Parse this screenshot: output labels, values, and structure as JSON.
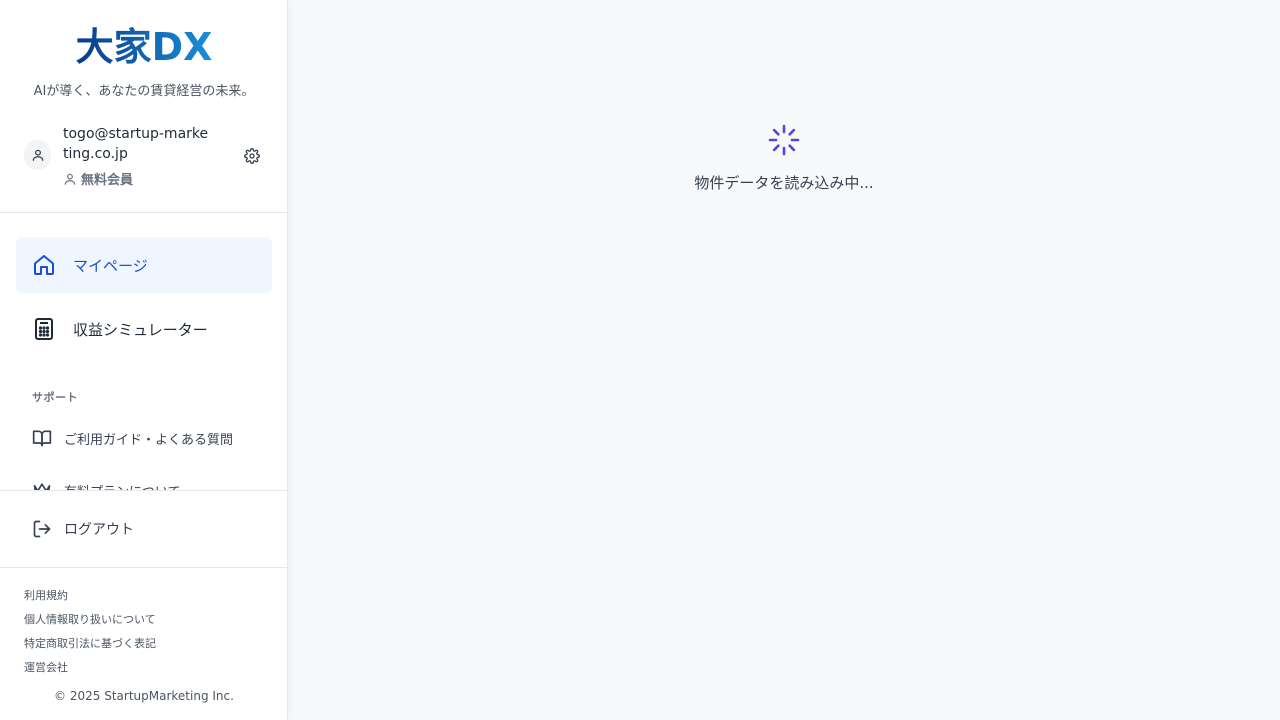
{
  "brand": {
    "logo_text": "大家DX",
    "tagline": "AIが導く、あなたの賃貸経営の未来。"
  },
  "user": {
    "email": "togo@startup-marketing.co.jp",
    "plan": "無料会員"
  },
  "nav": {
    "items": [
      {
        "label": "マイページ",
        "icon": "home-icon",
        "active": true
      },
      {
        "label": "収益シミュレーター",
        "icon": "calculator-icon",
        "active": false
      }
    ]
  },
  "support": {
    "section_label": "サポート",
    "items": [
      {
        "label": "ご利用ガイド・よくある質問",
        "icon": "book-open-icon"
      },
      {
        "label": "有料プランについて",
        "icon": "crown-icon"
      }
    ]
  },
  "logout_label": "ログアウト",
  "footer": {
    "links": [
      "利用規約",
      "個人情報取り扱いについて",
      "特定商取引法に基づく表記",
      "運営会社"
    ],
    "copyright": "© 2025 StartupMarketing Inc."
  },
  "main": {
    "loading_text": "物件データを読み込み中..."
  },
  "colors": {
    "accent": "#1d4ed8",
    "active_bg": "#eff6ff",
    "spinner": "#4f46e5",
    "logo_dark": "#0b3a8c",
    "logo_light": "#1a8fd8"
  }
}
